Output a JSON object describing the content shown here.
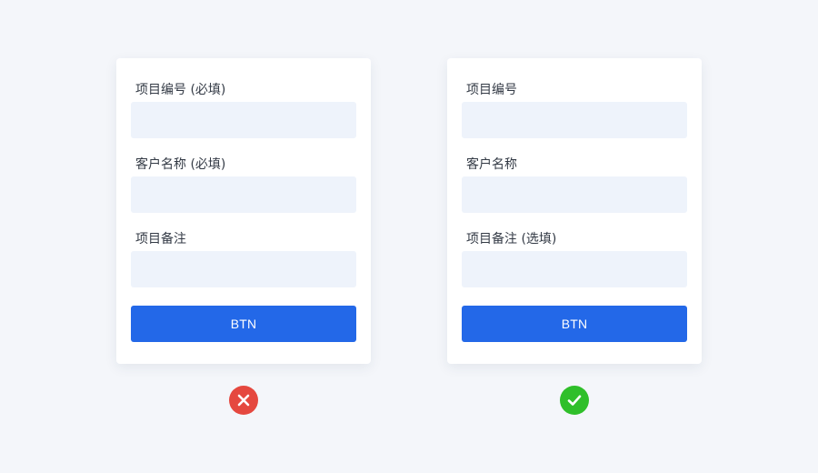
{
  "examples": {
    "incorrect": {
      "fields": [
        {
          "label": "项目编号 (必填)"
        },
        {
          "label": "客户名称 (必填)"
        },
        {
          "label": "项目备注"
        }
      ],
      "button_label": "BTN",
      "verdict_icon": "close-icon",
      "verdict_color": "#e5483f"
    },
    "correct": {
      "fields": [
        {
          "label": "项目编号"
        },
        {
          "label": "客户名称"
        },
        {
          "label": "项目备注 (选填)"
        }
      ],
      "button_label": "BTN",
      "verdict_icon": "check-icon",
      "verdict_color": "#2fbf2a"
    }
  },
  "colors": {
    "background": "#f4f6fa",
    "input_fill": "#eef3fb",
    "button": "#2368e8"
  }
}
